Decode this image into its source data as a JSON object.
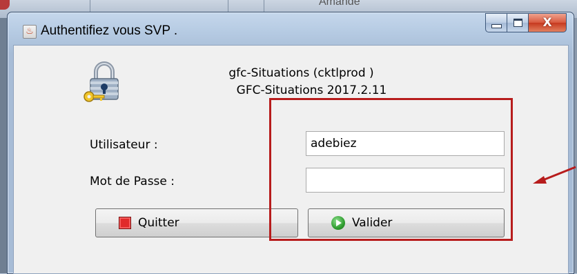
{
  "background": {
    "partial_text": "Amande"
  },
  "window": {
    "title": "Authentifiez vous SVP .",
    "controls": {
      "minimize": "minimize",
      "maximize": "maximize",
      "close": "X"
    }
  },
  "app_info": {
    "line1": "gfc-Situations (cktlprod )",
    "line2": "GFC-Situations 2017.2.11"
  },
  "form": {
    "user_label": "Utilisateur :",
    "user_value": "adebiez",
    "password_label": "Mot de Passe :",
    "password_value": ""
  },
  "buttons": {
    "quit_label": "Quitter",
    "validate_label": "Valider"
  },
  "colors": {
    "annotation": "#b71c1c",
    "content_bg": "#f0f0f0",
    "frame": "#b6cbe3"
  },
  "icons": {
    "app_icon": "java-cup-icon",
    "lock_icon": "padlock-key-icon",
    "quit_icon": "red-stop-icon",
    "validate_icon": "green-play-icon"
  }
}
